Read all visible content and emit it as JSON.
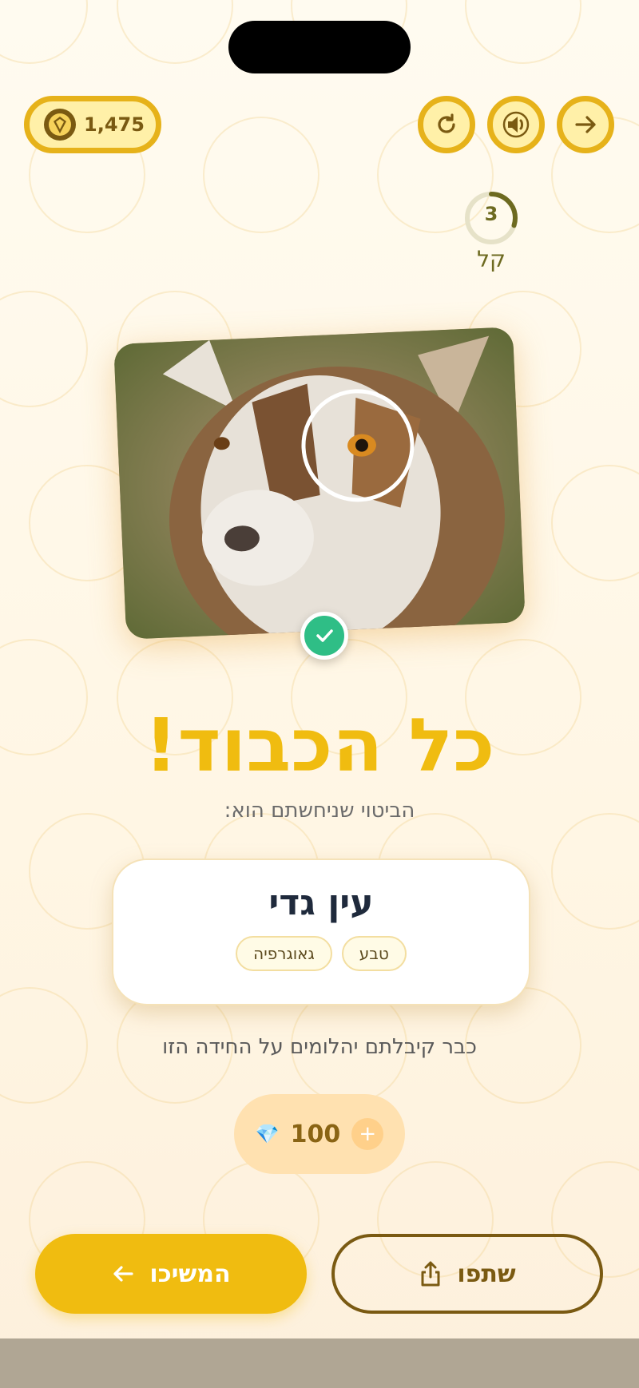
{
  "header": {
    "coins": "1,475"
  },
  "level": {
    "number": "3",
    "label": "קל",
    "progress": 0.3
  },
  "result": {
    "title": "כל הכבוד!",
    "subtitle": "הביטוי שניחשתם הוא:",
    "phrase": "עין גדי",
    "tags": [
      "טבע",
      "גאוגרפיה"
    ]
  },
  "note": "כבר קיבלתם יהלומים על החידה הזו",
  "reward": {
    "amount": "100",
    "plus": "+"
  },
  "buttons": {
    "continue_label": "המשיכו",
    "share_label": "שתפו"
  },
  "colors": {
    "accent": "#f0bc10",
    "accent_dark": "#e6b21a",
    "brown": "#7a5a12",
    "success": "#2fbe86",
    "text_dark": "#1f2a3c"
  },
  "icons": [
    "gem-icon",
    "restart-icon",
    "sound-icon",
    "forward-arrow-icon",
    "check-icon",
    "diamond-icon",
    "plus-icon",
    "arrow-left-icon",
    "share-icon"
  ]
}
